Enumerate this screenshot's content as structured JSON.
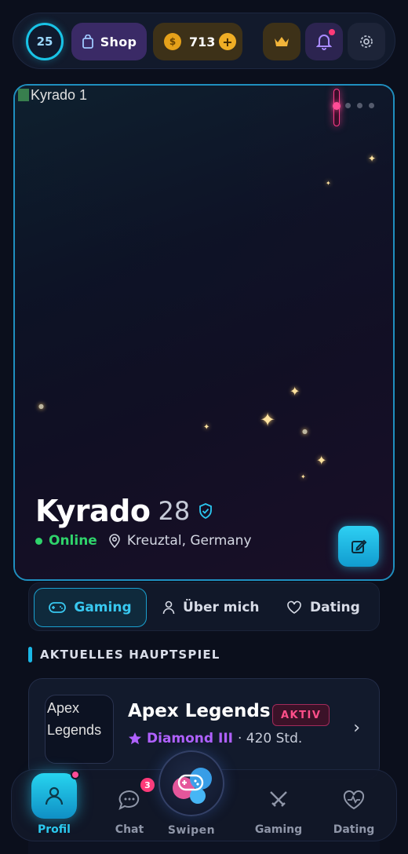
{
  "topbar": {
    "level": "25",
    "shop_label": "Shop",
    "coins": "713",
    "coin_add": "+"
  },
  "profile": {
    "image_alt": "Kyrado 1",
    "name": "Kyrado",
    "age": "28",
    "status": "Online",
    "location": "Kreuztal, Germany"
  },
  "tabs": [
    {
      "label": "Gaming"
    },
    {
      "label": "Über mich"
    },
    {
      "label": "Dating"
    }
  ],
  "section": {
    "title": "AKTUELLES HAUPTSPIEL"
  },
  "main_game": {
    "image_alt": "Apex Legends",
    "name": "Apex Legends",
    "badge": "AKTIV",
    "rank": "Diamond III",
    "hours": "· 420 Std."
  },
  "nav": {
    "profil": "Profil",
    "chat": "Chat",
    "chat_badge": "3",
    "swipe": "Swipen",
    "gaming": "Gaming",
    "dating": "Dating"
  },
  "colors": {
    "accent": "#19c3e6",
    "pink": "#ff3a78",
    "purple_rank": "#b061ff",
    "online": "#2fd36b",
    "gold": "#e5a11a"
  }
}
